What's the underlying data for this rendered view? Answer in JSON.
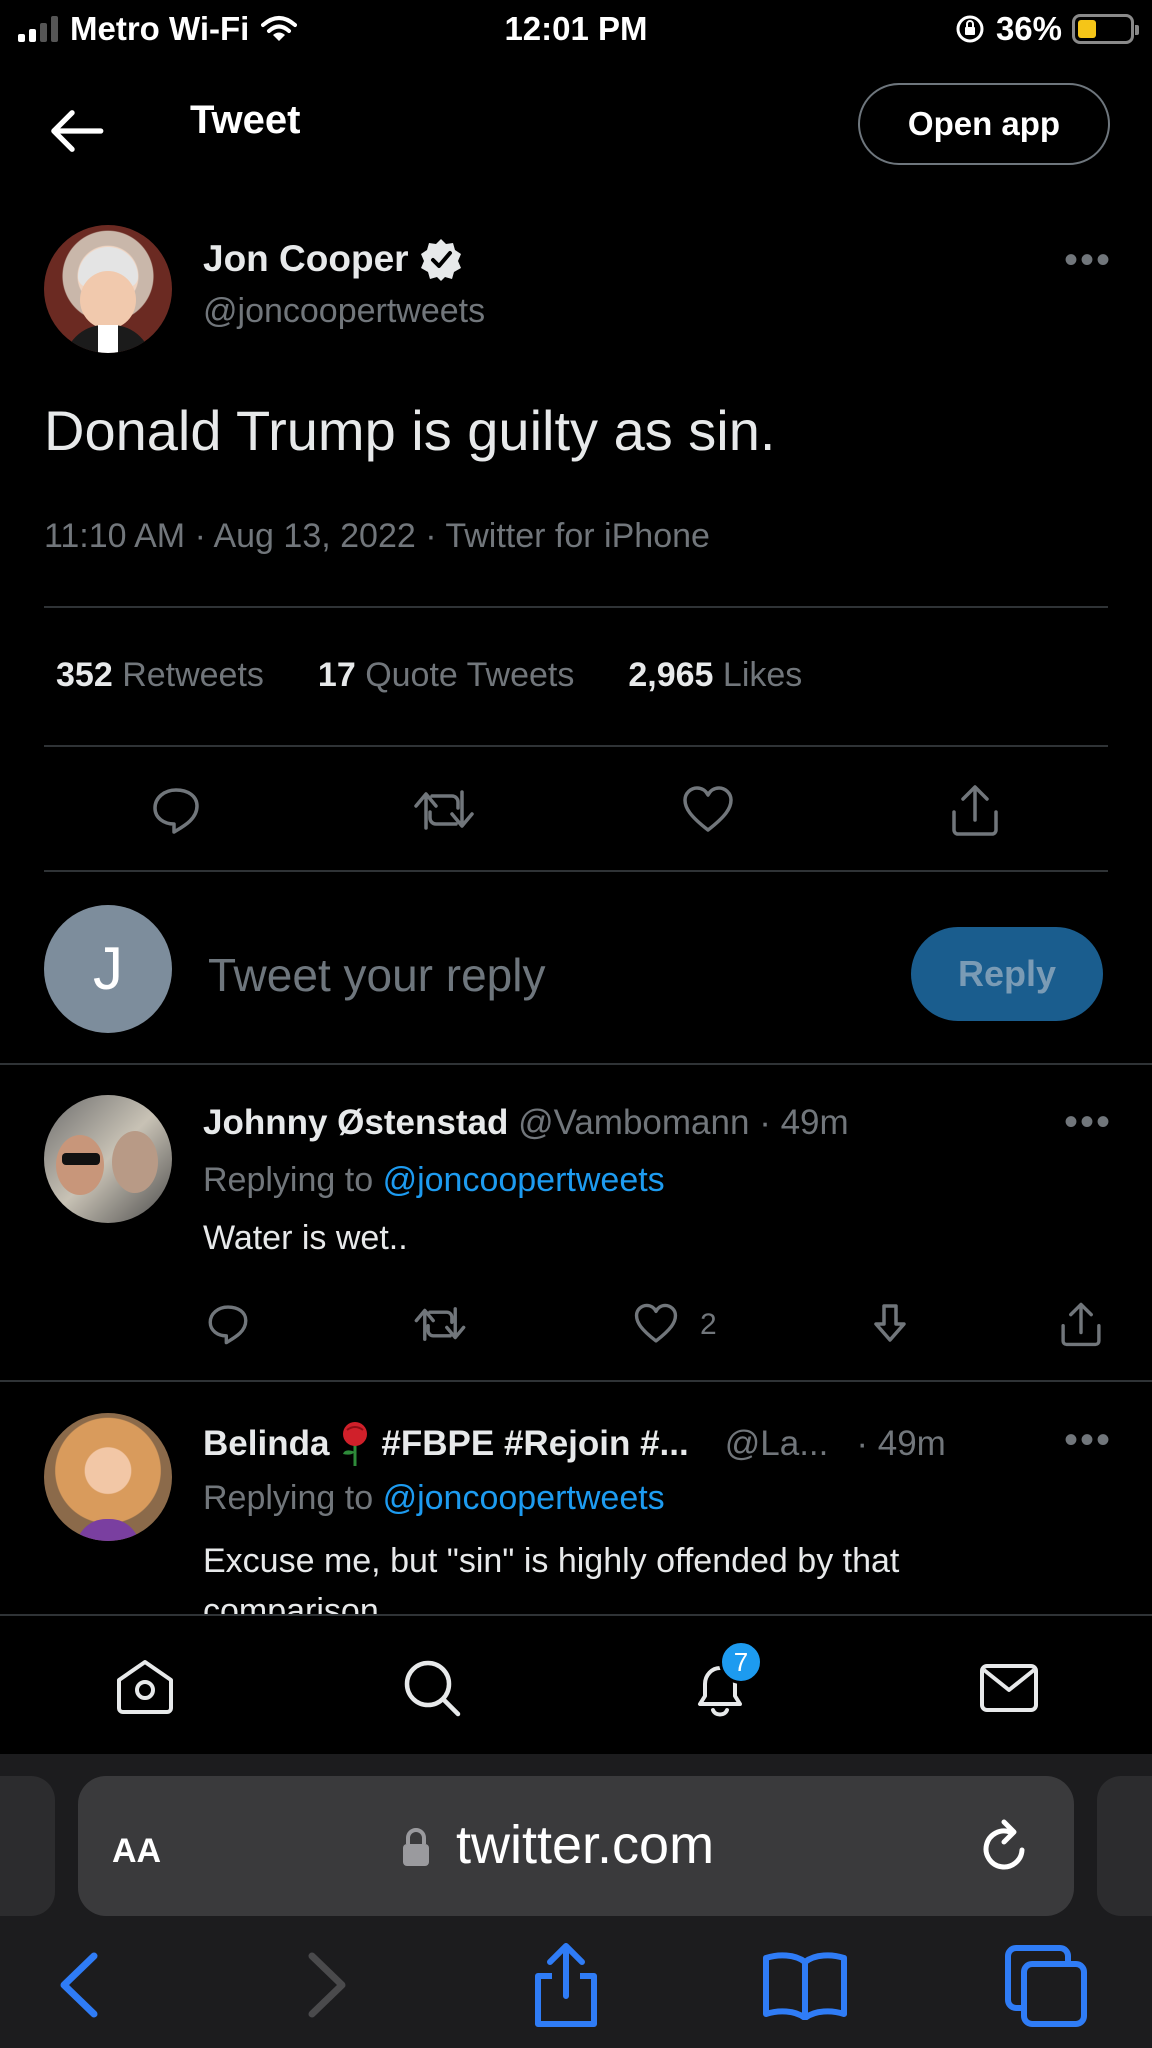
{
  "status_bar": {
    "carrier": "Metro Wi-Fi",
    "time": "12:01 PM",
    "battery_percent": "36%",
    "battery_level": 0.36
  },
  "header": {
    "title": "Tweet",
    "open_app_label": "Open app"
  },
  "tweet": {
    "author_name": "Jon Cooper",
    "author_handle": "@joncoopertweets",
    "text": "Donald Trump is guilty as sin.",
    "meta": "11:10 AM · Aug 13, 2022 · Twitter for iPhone",
    "stats": {
      "retweets_count": "352",
      "retweets_label": "Retweets",
      "quotes_count": "17",
      "quotes_label": "Quote Tweets",
      "likes_count": "2,965",
      "likes_label": "Likes"
    }
  },
  "composer": {
    "avatar_initial": "J",
    "placeholder": "Tweet your reply",
    "reply_button": "Reply"
  },
  "replies": [
    {
      "name": "Johnny Østenstad",
      "handle": "@Vambomann",
      "time": "· 49m",
      "replying_label": "Replying to",
      "replying_to": "@joncoopertweets",
      "text": "Water is wet..",
      "likes": "2"
    },
    {
      "name": "Belinda",
      "name_suffix": "#FBPE #Rejoin #...",
      "handle": "@La...",
      "time": "· 49m",
      "replying_label": "Replying to",
      "replying_to": "@joncoopertweets",
      "text": "Excuse me, but \"sin\" is highly offended by that comparison"
    }
  ],
  "tab_bar": {
    "notifications_badge": "7"
  },
  "safari": {
    "text_size_label": "AA",
    "url": "twitter.com"
  },
  "colors": {
    "background": "#000000",
    "accent": "#1d9bf0",
    "reply_button_bg": "#1a5d8e",
    "muted": "#71767b",
    "divider": "#2f3336",
    "safari_blue": "#2f7cf6"
  }
}
